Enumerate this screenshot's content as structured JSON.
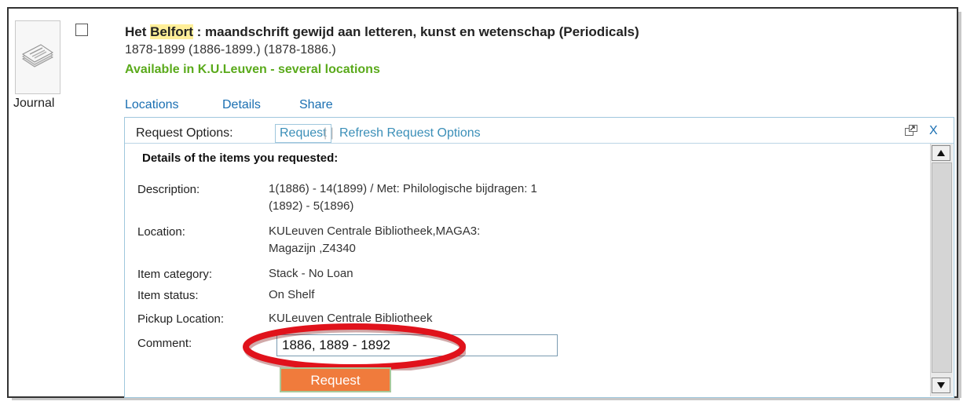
{
  "record": {
    "doc_type": "Journal",
    "title_prefix": "Het ",
    "title_highlight": "Belfort",
    "title_rest": " : maandschrift gewijd aan letteren, kunst en wetenschap (Periodicals)",
    "dates": "1878-1899 (1886-1899.) (1878-1886.)",
    "availability": "Available in K.U.Leuven - several locations"
  },
  "tabs": {
    "locations": "Locations",
    "details": "Details",
    "share": "Share"
  },
  "panel": {
    "options_label": "Request Options:",
    "request_tab": "Request",
    "separator": "| |",
    "refresh": "Refresh Request Options",
    "close": "X"
  },
  "details": {
    "heading": "Details of the items you requested:",
    "description_label": "Description:",
    "description_line1": "1(1886) - 14(1899) / Met: Philologische bijdragen: 1",
    "description_line2": "(1892) - 5(1896)",
    "location_label": "Location:",
    "location_line1": "KULeuven Centrale Bibliotheek,MAGA3:",
    "location_line2": "Magazijn ,Z4340",
    "category_label": "Item category:",
    "category": "Stack - No Loan",
    "status_label": "Item status:",
    "status": "On Shelf",
    "pickup_label": "Pickup Location:",
    "pickup": "KULeuven Centrale Bibliotheek",
    "comment_label": "Comment:",
    "comment_value": "1886, 1889 - 1892",
    "submit": "Request"
  },
  "colors": {
    "availability": "#5aaa1b",
    "link": "#1a6fb2",
    "request_button": "#f07b3c",
    "highlight_oval": "#e0121b"
  }
}
